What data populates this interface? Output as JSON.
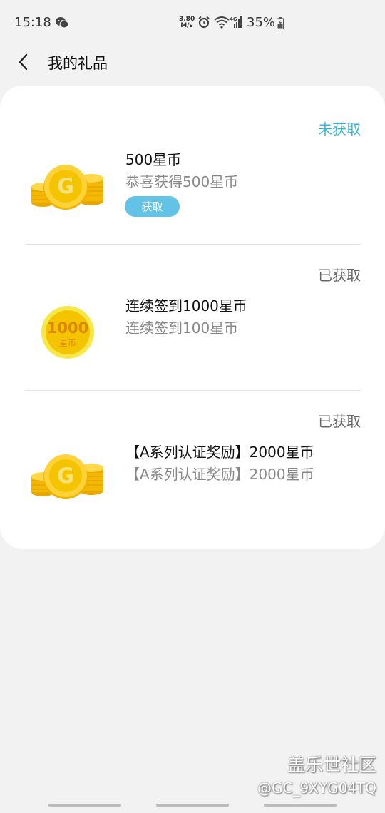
{
  "status_bar": {
    "time": "15:18",
    "net_speed_value": "3.80",
    "net_speed_unit": "M/s",
    "network_type": "4G",
    "battery": "35%"
  },
  "header": {
    "title": "我的礼品"
  },
  "gifts": [
    {
      "status": "未获取",
      "title": "500星币",
      "description": "恭喜获得500星币",
      "button_label": "获取",
      "coin_icon": "gold-g-coin-stack-icon"
    },
    {
      "status": "已获取",
      "title": "连续签到1000星币",
      "description": "连续签到100星币",
      "coin_icon": "1000-star-coin-icon",
      "coin_number": "1000",
      "coin_label": "星币"
    },
    {
      "status": "已获取",
      "title": "【A系列认证奖励】2000星币",
      "description": "【A系列认证奖励】2000星币",
      "coin_icon": "gold-g-coin-stack-icon"
    }
  ],
  "watermark": {
    "line1": "盖乐世社区",
    "line2": "@GC_9XYG04TQ"
  },
  "colors": {
    "pending_status": "#3bb3d6",
    "claim_button": "#62c3e7",
    "coin_gold": "#f5c400"
  }
}
